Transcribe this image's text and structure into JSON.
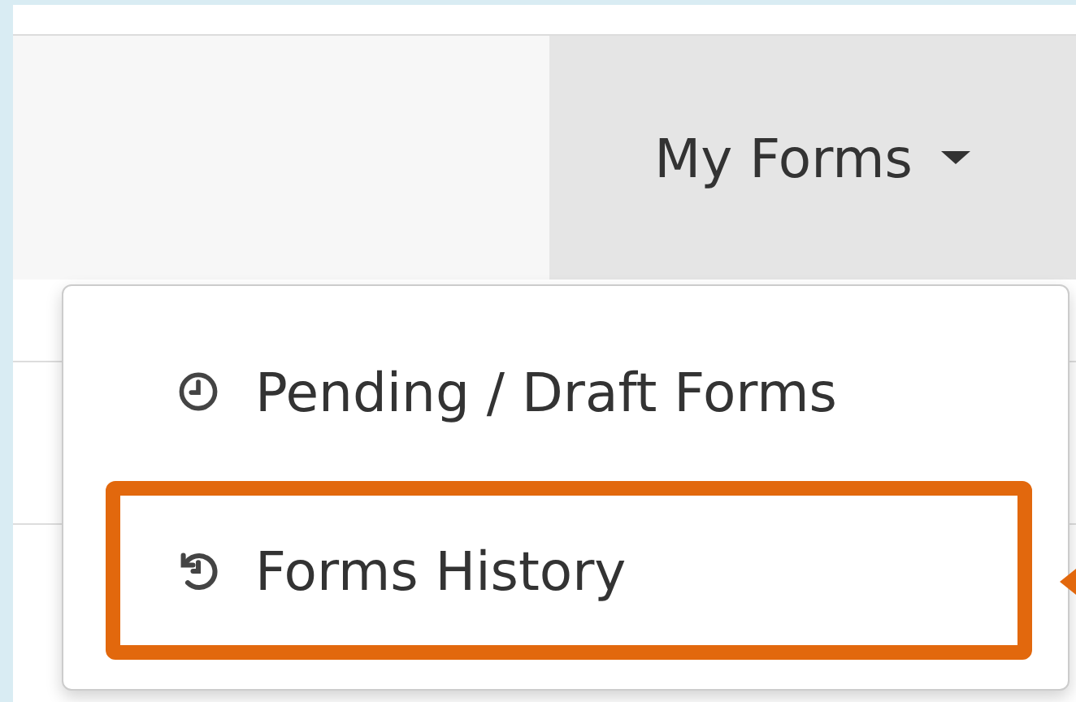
{
  "navbar": {
    "menu": {
      "label": "My Forms",
      "expanded": true
    }
  },
  "dropdown": {
    "items": [
      {
        "label": "Pending / Draft Forms",
        "kind": "clock",
        "highlighted": false
      },
      {
        "label": "Forms History",
        "kind": "history",
        "highlighted": true
      }
    ]
  }
}
